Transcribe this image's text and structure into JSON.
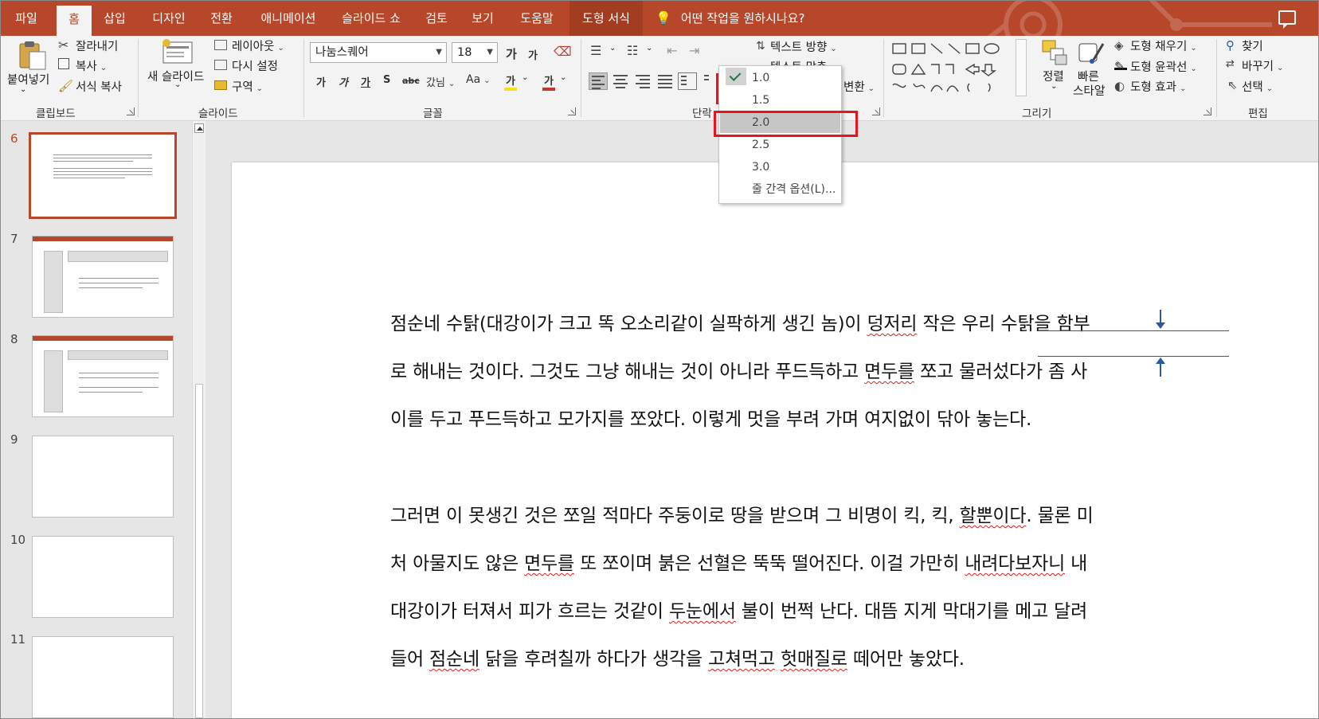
{
  "tabs": [
    "파일",
    "홈",
    "삽입",
    "디자인",
    "전환",
    "애니메이션",
    "슬라이드 쇼",
    "검토",
    "보기",
    "도움말",
    "도형 서식"
  ],
  "active_tab": "홈",
  "tell_me": "어떤 작업을 원하시나요?",
  "ribbon": {
    "clipboard": {
      "paste": "붙여넣기",
      "cut": "잘라내기",
      "copy": "복사",
      "format_painter": "서식 복사",
      "label": "클립보드"
    },
    "slides": {
      "new_slide": "새 슬라이드",
      "layout": "레이아웃",
      "reset": "다시 설정",
      "section": "구역",
      "label": "슬라이드"
    },
    "font": {
      "name": "나눔스퀘어",
      "size": "18",
      "label": "글꼴",
      "grow": "가",
      "shrink": "가",
      "bold": "가",
      "italic": "가",
      "underline": "가",
      "shadow": "S",
      "strike": "abc",
      "spacing": "갔님",
      "case": "Aa",
      "highlight": "가",
      "color": "가"
    },
    "paragraph": {
      "text_direction": "텍스트 방향",
      "align_text": "텍스트 맞춤",
      "smartart": "변환",
      "label": "단락"
    },
    "drawing": {
      "arrange": "정렬",
      "quick_styles_1": "빠른",
      "quick_styles_2": "스타일",
      "fill": "도형 채우기",
      "outline": "도형 윤곽선",
      "effects": "도형 효과",
      "label": "그리기"
    },
    "editing": {
      "find": "찾기",
      "replace": "바꾸기",
      "select": "선택",
      "label": "편집"
    }
  },
  "line_spacing_menu": {
    "options": [
      "1.0",
      "1.5",
      "2.0",
      "2.5",
      "3.0"
    ],
    "checked": "1.0",
    "hovered": "2.0",
    "more": "줄 간격 옵션(L)..."
  },
  "thumbnails": [
    {
      "num": "6",
      "active": true
    },
    {
      "num": "7",
      "active": false
    },
    {
      "num": "8",
      "active": false
    },
    {
      "num": "9",
      "active": false
    },
    {
      "num": "10",
      "active": false
    },
    {
      "num": "11",
      "active": false
    }
  ],
  "slide": {
    "lines": [
      "점순네 수탉(대강이가 크고 똑 오소리같이 실팍하게 생긴 놈)이 덩저리 작은 우리 수탉을 함부",
      "로 해내는 것이다. 그것도 그냥 해내는 것이 아니라 푸드득하고 면두를 쪼고 물러섰다가 좀 사",
      "이를 두고 푸드득하고 모가지를 쪼았다. 이렇게 멋을 부려 가며 여지없이 닦아 놓는다.",
      "그러면 이 못생긴 것은 쪼일 적마다 주둥이로 땅을 받으며 그 비명이 킥, 킥, 할뿐이다. 물론 미",
      "처 아물지도 않은 면두를 또 쪼이며 붉은 선혈은 뚝뚝 떨어진다. 이걸 가만히 내려다보자니 내",
      "대강이가 터져서 피가 흐르는 것같이 두눈에서 불이 번쩍 난다. 대뜸 지게 막대기를 메고 달려",
      "들어 점순네 닭을 후려칠까 하다가 생각을 고쳐먹고 헛매질로 떼어만 놓았다."
    ]
  }
}
